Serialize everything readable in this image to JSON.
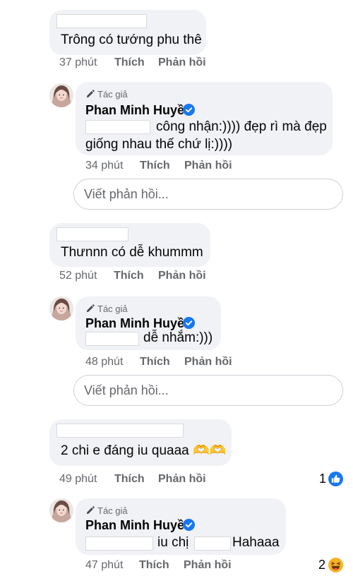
{
  "labels": {
    "like": "Thích",
    "reply": "Phản hồi",
    "author_tag": "Tác giả",
    "reply_placeholder": "Viết phản hồi..."
  },
  "comments": [
    {
      "text": "Trông có tướng phu thê",
      "time": "37 phút",
      "reply": {
        "author": "Phan Minh Huyền",
        "line1": "công nhận:)))) đẹp rì mà đẹp",
        "line2": "giống nhau thế chứ lị:))))",
        "time": "34 phút"
      }
    },
    {
      "text": "Thưnnn có dễ khummm",
      "time": "52 phút",
      "reply": {
        "author": "Phan Minh Huyền",
        "line1": "dễ nhắm:)))",
        "time": "48 phút"
      }
    },
    {
      "text": "2 chi e đáng iu quaaa 🫶🫶",
      "time": "49 phút",
      "reaction_count": "1",
      "reaction_type": "like-icon",
      "reply": {
        "author": "Phan Minh Huyền",
        "part1": "iu chị",
        "part2": "Hahaaa",
        "time": "47 phút",
        "reaction_count": "2",
        "reaction_type": "haha-icon"
      }
    }
  ],
  "colors": {
    "bubble": "#f0f2f5",
    "meta_text": "#65676b",
    "verified": "#1877f2",
    "like_reaction": "#1877f2",
    "haha_reaction": "#f7b125"
  }
}
